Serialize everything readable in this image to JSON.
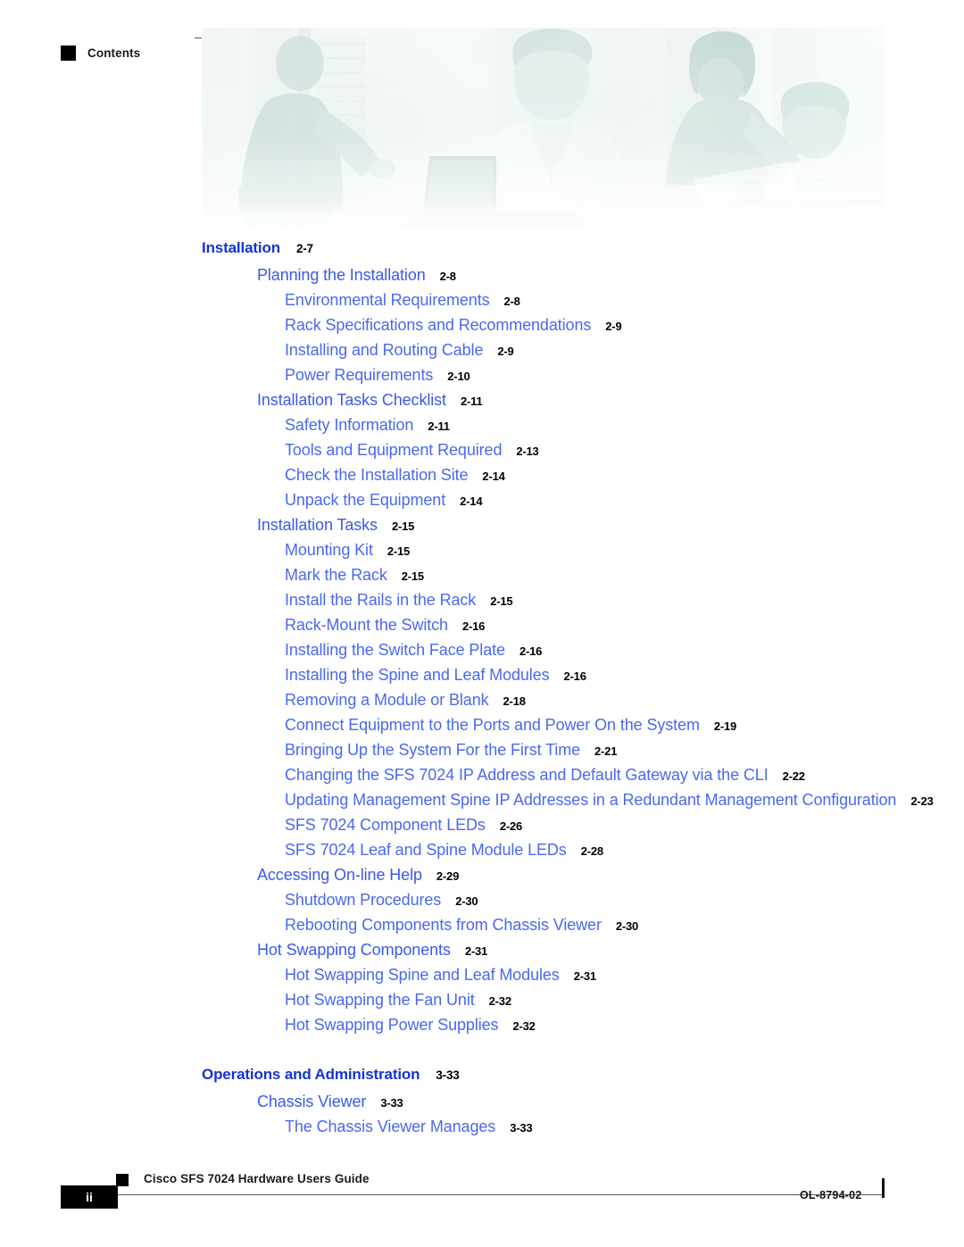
{
  "header": {
    "label": "Contents",
    "marker": "black-square-marker"
  },
  "banner": {
    "alt": "cisco-people-collaboration-banner"
  },
  "toc": {
    "entries": [
      {
        "level": 1,
        "title": "Installation",
        "page": "2-7",
        "gap": false
      },
      {
        "level": 2,
        "title": "Planning the Installation",
        "page": "2-8",
        "gap": false
      },
      {
        "level": 3,
        "title": "Environmental Requirements",
        "page": "2-8",
        "gap": false
      },
      {
        "level": 3,
        "title": "Rack Specifications and Recommendations",
        "page": "2-9",
        "gap": false
      },
      {
        "level": 3,
        "title": "Installing and Routing Cable",
        "page": "2-9",
        "gap": false
      },
      {
        "level": 3,
        "title": "Power Requirements",
        "page": "2-10",
        "gap": false
      },
      {
        "level": 2,
        "title": "Installation Tasks Checklist",
        "page": "2-11",
        "gap": false
      },
      {
        "level": 3,
        "title": "Safety Information",
        "page": "2-11",
        "gap": false
      },
      {
        "level": 3,
        "title": "Tools and Equipment Required",
        "page": "2-13",
        "gap": false
      },
      {
        "level": 3,
        "title": "Check the Installation Site",
        "page": "2-14",
        "gap": false
      },
      {
        "level": 3,
        "title": "Unpack the Equipment",
        "page": "2-14",
        "gap": false
      },
      {
        "level": 2,
        "title": "Installation Tasks",
        "page": "2-15",
        "gap": false
      },
      {
        "level": 3,
        "title": "Mounting Kit",
        "page": "2-15",
        "gap": false
      },
      {
        "level": 3,
        "title": "Mark the Rack",
        "page": "2-15",
        "gap": false
      },
      {
        "level": 3,
        "title": "Install the Rails in the Rack",
        "page": "2-15",
        "gap": false
      },
      {
        "level": 3,
        "title": "Rack-Mount the Switch",
        "page": "2-16",
        "gap": false
      },
      {
        "level": 3,
        "title": "Installing the Switch Face Plate",
        "page": "2-16",
        "gap": false
      },
      {
        "level": 3,
        "title": "Installing the Spine and Leaf Modules",
        "page": "2-16",
        "gap": false
      },
      {
        "level": 3,
        "title": "Removing a Module or Blank",
        "page": "2-18",
        "gap": false
      },
      {
        "level": 3,
        "title": "Connect Equipment to the Ports and Power On the System",
        "page": "2-19",
        "gap": false
      },
      {
        "level": 3,
        "title": "Bringing Up the System For the First Time",
        "page": "2-21",
        "gap": false
      },
      {
        "level": 3,
        "title": "Changing the SFS 7024 IP Address and Default Gateway via the CLI",
        "page": "2-22",
        "gap": false
      },
      {
        "level": 3,
        "title": "Updating Management Spine IP Addresses in a Redundant Management Configuration",
        "page": "2-23",
        "gap": false
      },
      {
        "level": 3,
        "title": "SFS 7024 Component LEDs",
        "page": "2-26",
        "gap": false
      },
      {
        "level": 3,
        "title": "SFS 7024 Leaf and Spine Module LEDs",
        "page": "2-28",
        "gap": false
      },
      {
        "level": 2,
        "title": "Accessing On-line Help",
        "page": "2-29",
        "gap": false
      },
      {
        "level": 3,
        "title": "Shutdown Procedures",
        "page": "2-30",
        "gap": false
      },
      {
        "level": 3,
        "title": "Rebooting Components from Chassis Viewer",
        "page": "2-30",
        "gap": false
      },
      {
        "level": 2,
        "title": "Hot Swapping Components",
        "page": "2-31",
        "gap": false
      },
      {
        "level": 3,
        "title": "Hot Swapping Spine and Leaf Modules",
        "page": "2-31",
        "gap": false
      },
      {
        "level": 3,
        "title": "Hot Swapping the Fan Unit",
        "page": "2-32",
        "gap": false
      },
      {
        "level": 3,
        "title": "Hot Swapping Power Supplies",
        "page": "2-32",
        "gap": false
      },
      {
        "level": 1,
        "title": "Operations and Administration",
        "page": "3-33",
        "gap": true
      },
      {
        "level": 2,
        "title": "Chassis Viewer",
        "page": "3-33",
        "gap": false
      },
      {
        "level": 3,
        "title": "The Chassis Viewer Manages",
        "page": "3-33",
        "gap": false
      }
    ]
  },
  "footer": {
    "page_number": "ii",
    "document_title": "Cisco SFS 7024 Hardware Users Guide",
    "doc_id": "OL-8794-02"
  },
  "colors": {
    "level1": "#1433d4",
    "level2": "#3b5ae8",
    "level3": "#4a68ef",
    "page_number_text": "#000000",
    "rule": "#5a5a5a",
    "marker": "#000000"
  }
}
